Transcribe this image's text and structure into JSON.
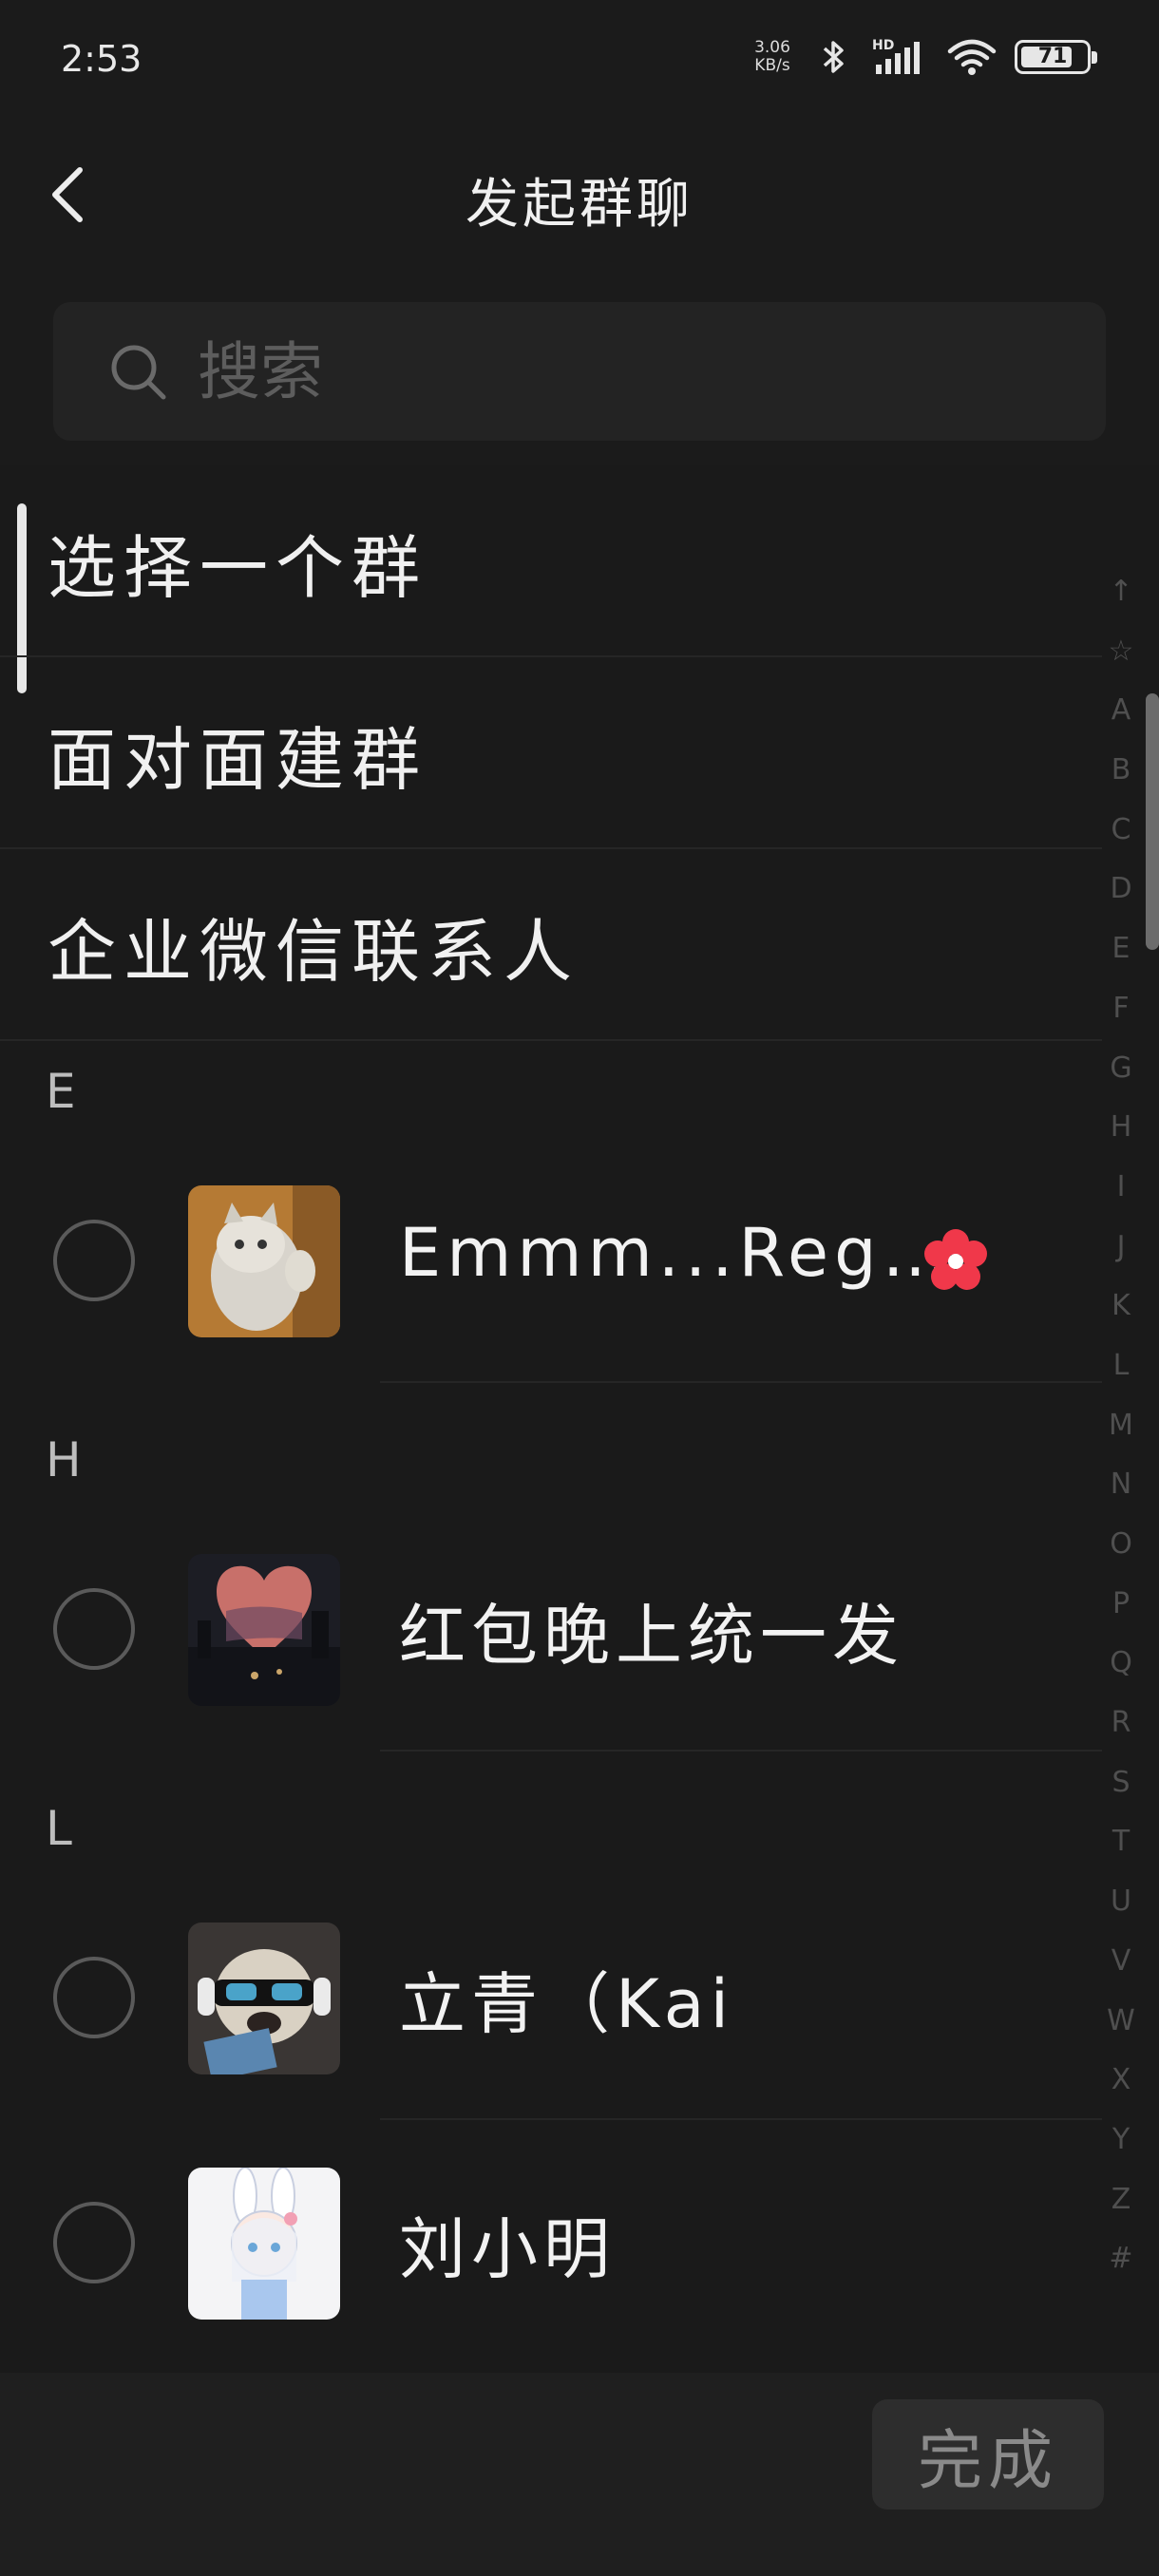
{
  "status_bar": {
    "time": "2:53",
    "net_speed_value": "3.06",
    "net_speed_unit": "KB/s",
    "battery": "71"
  },
  "nav": {
    "title": "发起群聊"
  },
  "search": {
    "placeholder": "搜索"
  },
  "options": [
    {
      "label": "选择一个群"
    },
    {
      "label": "面对面建群"
    },
    {
      "label": "企业微信联系人"
    }
  ],
  "sections": [
    {
      "letter": "E",
      "contacts": [
        {
          "name": "Emmm...Reg…",
          "icon": "red-flower-icon"
        }
      ]
    },
    {
      "letter": "H",
      "contacts": [
        {
          "name": "红包晚上统一发"
        }
      ]
    },
    {
      "letter": "L",
      "contacts": [
        {
          "name": "立青（Kai"
        },
        {
          "name": "刘小明"
        }
      ]
    }
  ],
  "index_bar": [
    "↑",
    "☆",
    "A",
    "B",
    "C",
    "D",
    "E",
    "F",
    "G",
    "H",
    "I",
    "J",
    "K",
    "L",
    "M",
    "N",
    "O",
    "P",
    "Q",
    "R",
    "S",
    "T",
    "U",
    "V",
    "W",
    "X",
    "Y",
    "Z",
    "#"
  ],
  "footer": {
    "done_label": "完成"
  },
  "colors": {
    "background": "#1b1b1b",
    "surface": "#232323",
    "text": "#f0f0f0",
    "flower": "#f0384a"
  }
}
